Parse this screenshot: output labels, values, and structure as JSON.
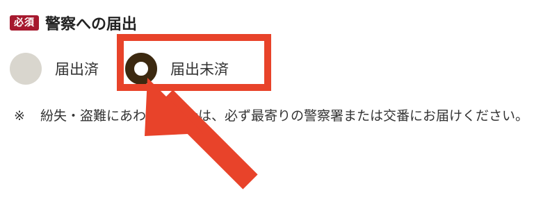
{
  "form": {
    "required_badge": "必須",
    "title": "警察への届出",
    "options": [
      {
        "label": "届出済",
        "selected": false
      },
      {
        "label": "届出未済",
        "selected": true
      }
    ],
    "note_mark": "※",
    "note_text": "紛失・盗難にあわれた場合は、必ず最寄りの警察署または交番にお届けください。"
  },
  "annotation": {
    "color": "#e8432a",
    "target": "届出未済"
  }
}
